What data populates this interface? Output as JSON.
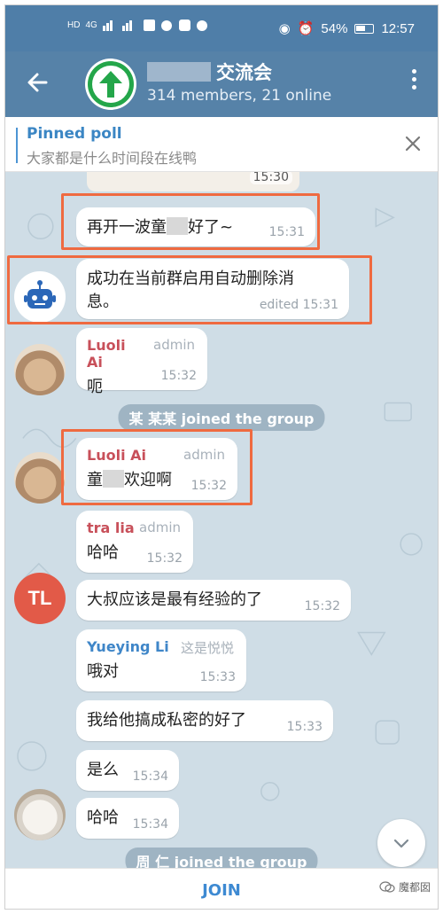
{
  "status_bar": {
    "left_text": "HD",
    "signal": "4G",
    "battery_pct": "54%",
    "time": "12:57"
  },
  "header": {
    "title": "交流会",
    "subtitle": "314 members, 21 online"
  },
  "pinned": {
    "title": "Pinned poll",
    "text": "大家都是什么时间段在线鸭"
  },
  "messages": {
    "top_time": "15:30",
    "m1": {
      "text_a": "再开一波童",
      "text_b": "好了~",
      "time": "15:31"
    },
    "m2": {
      "line1": "成功在当前群启用自动删除消",
      "line2": "息。",
      "time": "edited 15:31"
    },
    "m3": {
      "name": "Luoli Ai",
      "role": "admin",
      "text": "呃",
      "time": "15:32"
    },
    "svc1": "某 某某 joined the group",
    "m4": {
      "name": "Luoli Ai",
      "role": "admin",
      "text_a": "童",
      "text_b": "欢迎啊",
      "time": "15:32"
    },
    "m5": {
      "name": "tra lia",
      "role": "admin",
      "text": "哈哈",
      "time": "15:32"
    },
    "m6": {
      "avatar": "TL",
      "text": "大叔应该是最有经验的了",
      "time": "15:32"
    },
    "m7": {
      "name": "Yueying Li",
      "role": "这是悦悦",
      "text": "哦对",
      "time": "15:33"
    },
    "m8": {
      "text": "我给他搞成私密的好了",
      "time": "15:33"
    },
    "m9": {
      "text": "是么",
      "time": "15:34"
    },
    "m10": {
      "text": "哈哈",
      "time": "15:34"
    },
    "svc2": "周 仁 joined the group"
  },
  "bottom": {
    "join_label": "JOIN",
    "watermark": "魔都囡"
  },
  "colors": {
    "header": "#5682a8",
    "accent": "#3e8ad2",
    "highlight": "#ef6a40",
    "admin_name": "#c8505a",
    "blue_name": "#3f86c8"
  },
  "icons": [
    "back-arrow-icon",
    "menu-icon",
    "close-icon",
    "chevron-down-icon",
    "robot-icon"
  ]
}
